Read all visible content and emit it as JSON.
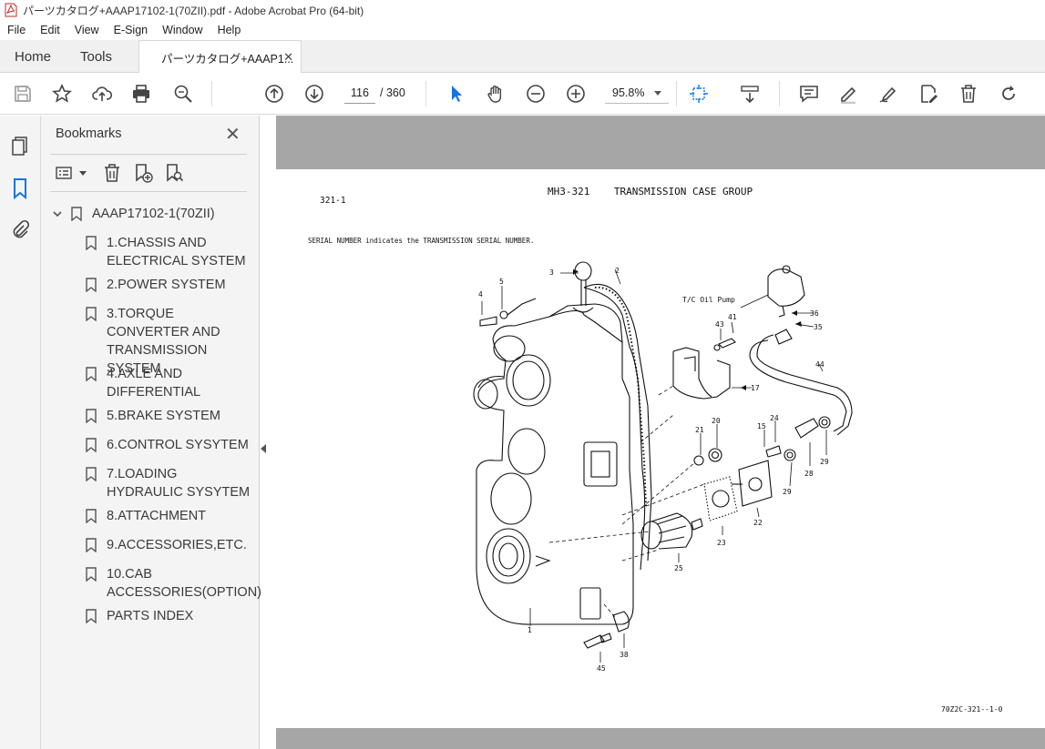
{
  "window": {
    "title": "パーツカタログ+AAAP17102-1(70ZII).pdf - Adobe Acrobat Pro (64-bit)"
  },
  "menu": [
    "File",
    "Edit",
    "View",
    "E-Sign",
    "Window",
    "Help"
  ],
  "tabs": {
    "home": "Home",
    "tools": "Tools",
    "document": "パーツカタログ+AAAP1..."
  },
  "toolbar": {
    "page_current": "116",
    "page_total": "/ 360",
    "zoom": "95.8%"
  },
  "bookmarks": {
    "title": "Bookmarks",
    "root": "AAAP17102-1(70ZII)",
    "items": [
      {
        "label": "1.CHASSIS AND ELECTRICAL SYSTEM"
      },
      {
        "label": "2.POWER SYSTEM"
      },
      {
        "label": "3.TORQUE CONVERTER AND TRANSMISSION SYSTEM"
      },
      {
        "label": "4.AXLE AND DIFFERENTIAL"
      },
      {
        "label": "5.BRAKE SYSTEM"
      },
      {
        "label": "6.CONTROL SYSYTEM"
      },
      {
        "label": "7.LOADING HYDRAULIC SYSYTEM"
      },
      {
        "label": "8.ATTACHMENT"
      },
      {
        "label": "9.ACCESSORIES,ETC."
      },
      {
        "label": "10.CAB ACCESSORIES(OPTION)"
      },
      {
        "label": "PARTS INDEX"
      }
    ]
  },
  "document": {
    "page_ref": "321-1",
    "header": "MH3-321    TRANSMISSION CASE GROUP",
    "note": "SERIAL NUMBER indicates the TRANSMISSION SERIAL NUMBER.",
    "pump_label": "T/C Oil Pump",
    "footer": "70Z2C-321--1-0",
    "part_numbers": [
      "1",
      "2",
      "3",
      "4",
      "5",
      "17",
      "20",
      "21",
      "22",
      "23",
      "24",
      "25",
      "28",
      "29",
      "29",
      "35",
      "36",
      "38",
      "41",
      "43",
      "44",
      "45",
      "15"
    ]
  }
}
